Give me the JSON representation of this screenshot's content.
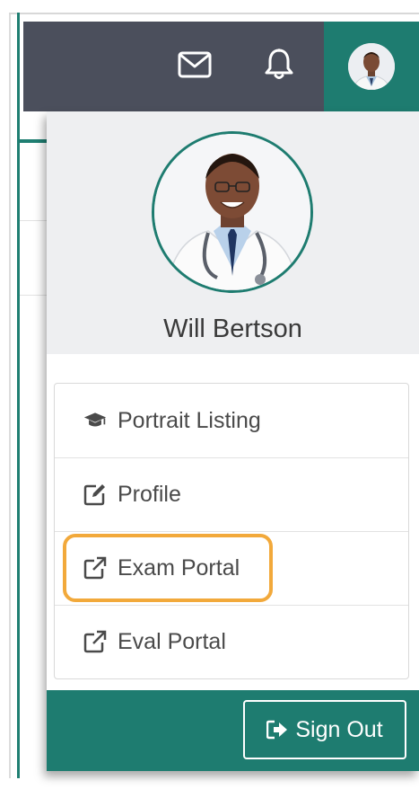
{
  "topbar": {
    "icons": [
      "mail-icon",
      "bell-icon"
    ],
    "background": "#4b4f5c",
    "accent": "#1e7c70"
  },
  "profile": {
    "name": "Will Bertson"
  },
  "menu": {
    "items": [
      {
        "label": "Portrait Listing",
        "icon": "graduation-cap-icon"
      },
      {
        "label": "Profile",
        "icon": "edit-icon"
      },
      {
        "label": "Exam Portal",
        "icon": "external-link-icon"
      },
      {
        "label": "Eval Portal",
        "icon": "external-link-icon"
      }
    ],
    "highlighted": "Exam Portal",
    "highlight_color": "#f2a93b"
  },
  "footer": {
    "signout_label": "Sign Out",
    "signout_icon": "sign-out-icon"
  }
}
